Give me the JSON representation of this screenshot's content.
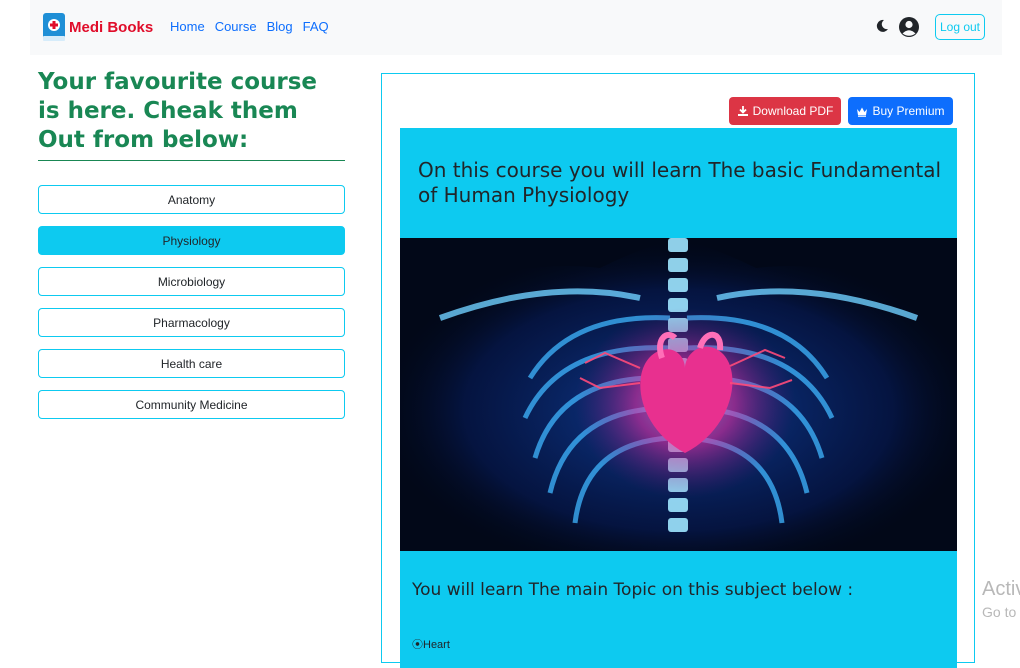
{
  "navbar": {
    "brand": "Medi Books",
    "links": [
      "Home",
      "Course",
      "Blog",
      "FAQ"
    ],
    "logout_label": "Log out",
    "icons": {
      "logo": "book-medical-icon",
      "theme": "moon-icon",
      "profile": "user-circle-icon"
    }
  },
  "sidebar": {
    "heading": "Your favourite course is here. Cheak them Out from below:",
    "courses": [
      "Anatomy",
      "Physiology",
      "Microbiology",
      "Pharmacology",
      "Health care",
      "Community Medicine"
    ],
    "active_course": "Physiology"
  },
  "main": {
    "download_label": "Download PDF",
    "premium_label": "Buy Premium",
    "title": "On this course you will learn The basic Fundamental of Human Physiology",
    "subtitle": "You will learn The main Topic on this subject below :",
    "topic_marker": "⦿",
    "topic": "Heart",
    "hero_image": "glowing-heart-xray-icon"
  },
  "os_overlay": {
    "line1": "Activ",
    "line2": "Go to"
  },
  "colors": {
    "brand": "#e00d2a",
    "accent": "#0dcaf0",
    "heading": "#198754",
    "danger": "#dc3545",
    "primary": "#0d6efd"
  }
}
